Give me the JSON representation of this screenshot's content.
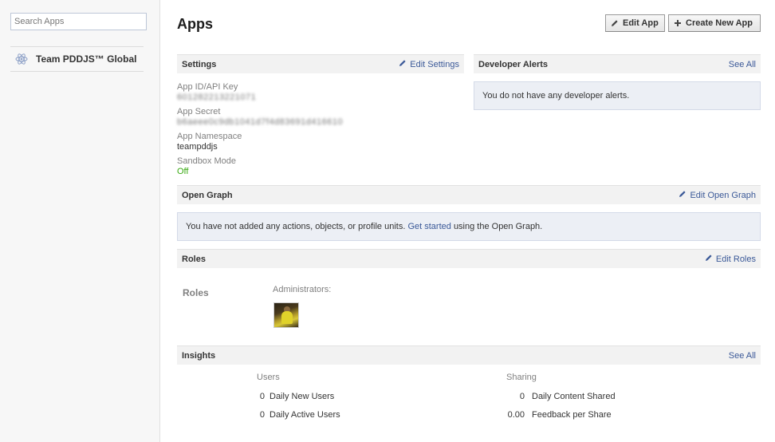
{
  "sidebar": {
    "search": {
      "placeholder": "Search Apps",
      "value": ""
    },
    "apps": [
      {
        "name": "Team PDDJS™ Global",
        "icon": "react-atom-icon"
      }
    ]
  },
  "header": {
    "title": "Apps",
    "edit_app_label": "Edit App",
    "create_new_app_label": "Create New App"
  },
  "settings": {
    "title": "Settings",
    "edit_label": "Edit Settings",
    "fields": [
      {
        "label": "App ID/API Key",
        "value": "601282213221071",
        "obscured": true
      },
      {
        "label": "App Secret",
        "value": "b6aeee0c9db1041d7f4d83691d416610",
        "obscured": true
      },
      {
        "label": "App Namespace",
        "value": "teampddjs",
        "obscured": false
      },
      {
        "label": "Sandbox Mode",
        "value": "Off",
        "obscured": false,
        "color": "#36a80f"
      }
    ]
  },
  "developer_alerts": {
    "title": "Developer Alerts",
    "see_all_label": "See All",
    "message": "You do not have any developer alerts."
  },
  "open_graph": {
    "title": "Open Graph",
    "edit_label": "Edit Open Graph",
    "message_before": "You have not added any actions, objects, or profile units.",
    "link_text": "Get started",
    "message_after": "using the Open Graph."
  },
  "roles": {
    "title": "Roles",
    "edit_label": "Edit Roles",
    "row_label": "Roles",
    "administrators_label": "Administrators:"
  },
  "insights": {
    "title": "Insights",
    "see_all_label": "See All",
    "users": {
      "title": "Users",
      "rows": [
        {
          "value": "0",
          "label": "Daily New Users"
        },
        {
          "value": "0",
          "label": "Daily Active Users"
        }
      ]
    },
    "sharing": {
      "title": "Sharing",
      "rows": [
        {
          "value": "0",
          "label": "Daily Content Shared"
        },
        {
          "value": "0.00",
          "label": "Feedback per Share"
        }
      ]
    }
  },
  "colors": {
    "link": "#3b5998",
    "sandbox_off": "#36a80f",
    "info_box_bg": "#eceff5"
  }
}
